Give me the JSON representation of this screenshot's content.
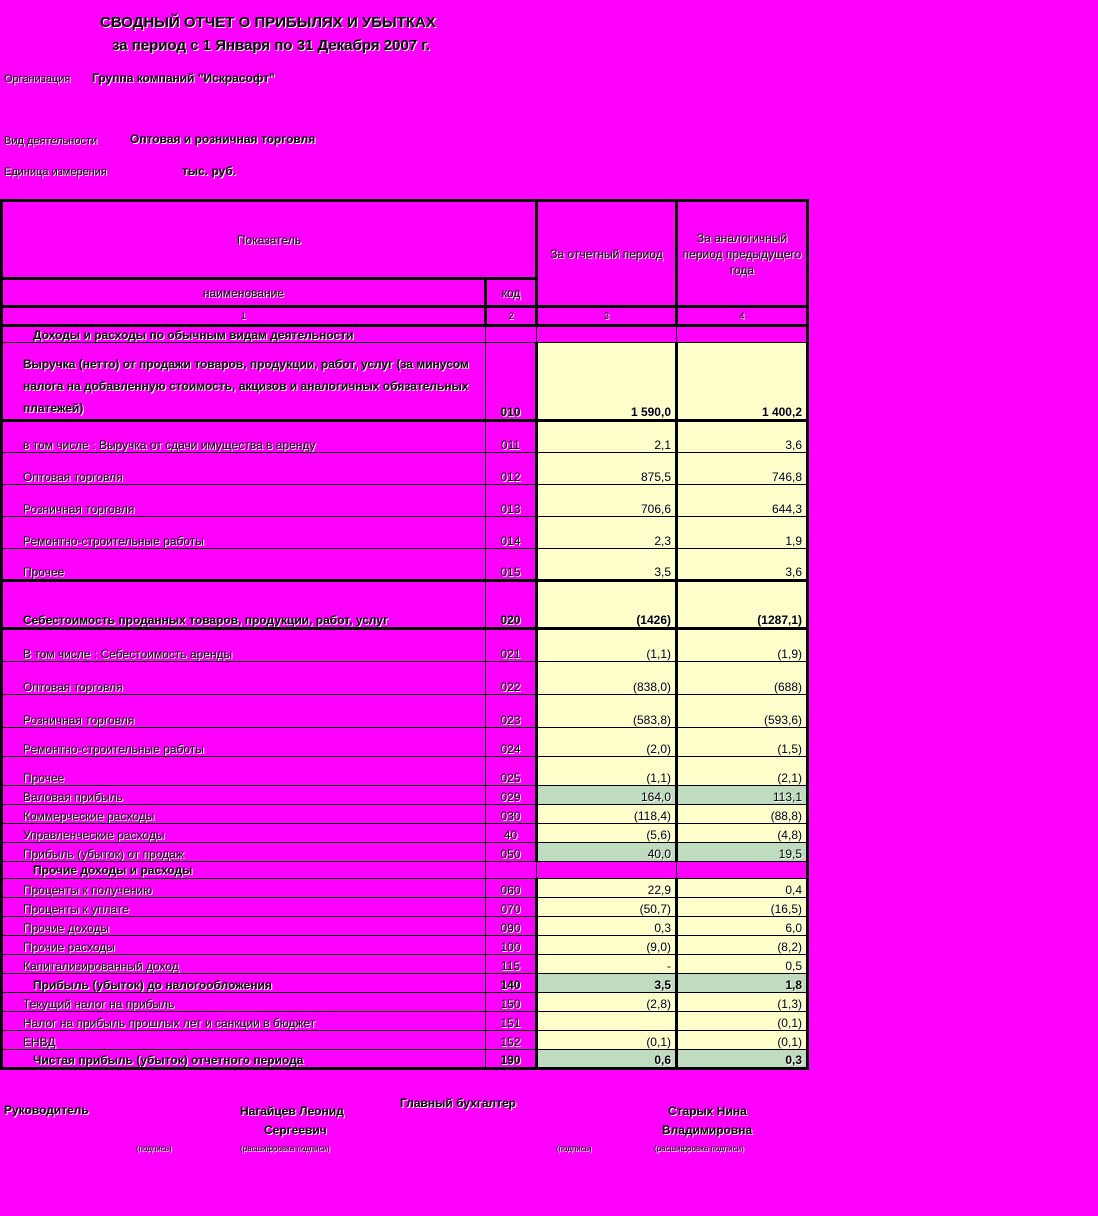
{
  "header": {
    "title_line1": "СВОДНЫЙ ОТЧЕТ О ПРИБЫЛЯХ И УБЫТКАХ",
    "title_line2": "за  период с 1 Января по 31 Декабря 2007 г.",
    "org_label": "Организация",
    "org_value": "Группа компаний \"Искрасофт\"",
    "activity_label": "Вид деятельности",
    "activity_value": "Оптовая и розничная торговля",
    "unit_label": "Единица измерения",
    "unit_value": "тыс. руб."
  },
  "table": {
    "col_indicator": "Показатель",
    "col_current": "За отчетный период",
    "col_previous": "За аналогичный период предыдущего года",
    "col_name": "наименование",
    "col_code": "код",
    "num1": "1",
    "num2": "2",
    "num3": "3",
    "num4": "4",
    "section1": "Доходы и расходы по обычным видам деятельности",
    "section2": "Прочие доходы и расходы",
    "rows": [
      {
        "name": "Выручка (нетто) от продажи товаров, продукции, работ, услуг (за минусом налога на добавленную стоимость, акцизов и аналогичных обязательных платежей)",
        "code": "010",
        "cur": "1 590,0",
        "prev": "1 400,2"
      },
      {
        "name": "в том числе : Выручка от сдачи имущества в аренду",
        "code": "011",
        "cur": "2,1",
        "prev": "3,6"
      },
      {
        "name": "Оптовая торговля",
        "code": "012",
        "cur": "875,5",
        "prev": "746,8"
      },
      {
        "name": "Розничная торговля",
        "code": "013",
        "cur": "706,6",
        "prev": "644,3"
      },
      {
        "name": "Ремонтно-строительные работы",
        "code": "014",
        "cur": "2,3",
        "prev": "1,9"
      },
      {
        "name": "Прочее",
        "code": "015",
        "cur": "3,5",
        "prev": "3,6"
      },
      {
        "name": "Себестоимость проданных товаров, продукции, работ, услуг",
        "code": "020",
        "cur": "(1426)",
        "prev": "(1287,1)"
      },
      {
        "name": "В том числе : Себестоимость аренды",
        "code": "021",
        "cur": "(1,1)",
        "prev": "(1,9)"
      },
      {
        "name": "Оптовая торговля",
        "code": "022",
        "cur": "(838,0)",
        "prev": "(688)"
      },
      {
        "name": "Розничная торговля",
        "code": "023",
        "cur": "(583,8)",
        "prev": "(593,6)"
      },
      {
        "name": "Ремонтно-строительные работы",
        "code": "024",
        "cur": "(2,0)",
        "prev": "(1,5)"
      },
      {
        "name": "Прочее",
        "code": "025",
        "cur": "(1,1)",
        "prev": "(2,1)"
      },
      {
        "name": "Валовая прибыль",
        "code": "029",
        "cur": "164,0",
        "prev": "113,1"
      },
      {
        "name": "Коммерческие расходы",
        "code": "030",
        "cur": "(118,4)",
        "prev": "(88,8)"
      },
      {
        "name": "Управленческие расходы",
        "code": "40",
        "cur": "(5,6)",
        "prev": "(4,8)"
      },
      {
        "name": "Прибыль (убыток) от продаж",
        "code": "050",
        "cur": "40,0",
        "prev": "19,5"
      },
      {
        "name": "Проценты к получению",
        "code": "060",
        "cur": "22,9",
        "prev": "0,4"
      },
      {
        "name": "Проценты к уплате",
        "code": "070",
        "cur": "(50,7)",
        "prev": "(16,5)"
      },
      {
        "name": "Прочие  доходы",
        "code": "090",
        "cur": "0,3",
        "prev": "6,0"
      },
      {
        "name": "Прочие расходы",
        "code": "100",
        "cur": "(9,0)",
        "prev": "(8,2)"
      },
      {
        "name": "Капитализированный доход",
        "code": "115",
        "cur": "-",
        "prev": "0,5"
      },
      {
        "name": "Прибыль (убыток) до налогообложения",
        "code": "140",
        "cur": "3,5",
        "prev": "1,8"
      },
      {
        "name": "Текущий налог на прибыль",
        "code": "150",
        "cur": "(2,8)",
        "prev": "(1,3)"
      },
      {
        "name": "Налог на прибыль прошлых лет и санкции в бюджет",
        "code": "151",
        "cur": "",
        "prev": "(0,1)"
      },
      {
        "name": "ЕНВД",
        "code": "152",
        "cur": "(0,1)",
        "prev": "(0,1)"
      },
      {
        "name": "Чистая прибыль (убыток) отчетного периода",
        "code": "190",
        "cur": "0,6",
        "prev": "0,3"
      }
    ]
  },
  "footer": {
    "head_label": "Руководитель",
    "head_name1": "Нагайцев Леонид",
    "head_name2": "Сергеевич",
    "acc_label": "Главный бухгалтер",
    "acc_name1": "Старых Нина",
    "acc_name2": "Владимировна",
    "sign1": "(подпись)",
    "decode1": "(расшифровка подписи)",
    "sign2": "(подпись)",
    "decode2": "(расшифровка подписи)"
  }
}
